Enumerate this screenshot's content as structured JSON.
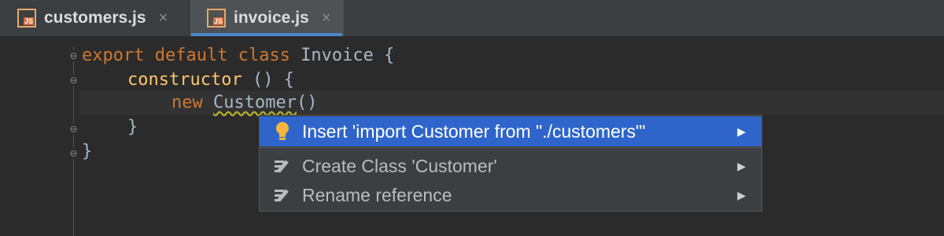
{
  "tabs": [
    {
      "label": "customers.js",
      "icon": "js-file-icon",
      "close": "×",
      "active": false
    },
    {
      "label": "invoice.js",
      "icon": "js-file-icon",
      "close": "×",
      "active": true
    }
  ],
  "code": {
    "line1": {
      "kw1": "export",
      "kw2": "default",
      "kw3": "class",
      "name": "Invoice",
      "brace": "{"
    },
    "line2": {
      "fn": "constructor",
      "rest": "() {"
    },
    "line3": {
      "kw": "new",
      "ident": "Customer",
      "rest": "()"
    },
    "line4": {
      "text": "}"
    },
    "line5": {
      "text": "}"
    }
  },
  "popup": {
    "items": [
      {
        "label": "Insert 'import Customer from \"./customers\"'",
        "icon": "lightbulb-icon",
        "arrow": "▶",
        "selected": true
      },
      {
        "label": "Create Class 'Customer'",
        "icon": "edit-icon",
        "arrow": "▶",
        "selected": false
      },
      {
        "label": "Rename reference",
        "icon": "edit-icon",
        "arrow": "▶",
        "selected": false
      }
    ]
  },
  "colors": {
    "selection": "#2f65ca",
    "keyword": "#cc7832",
    "function": "#ffc66d",
    "tab_underline": "#4a88c7"
  }
}
